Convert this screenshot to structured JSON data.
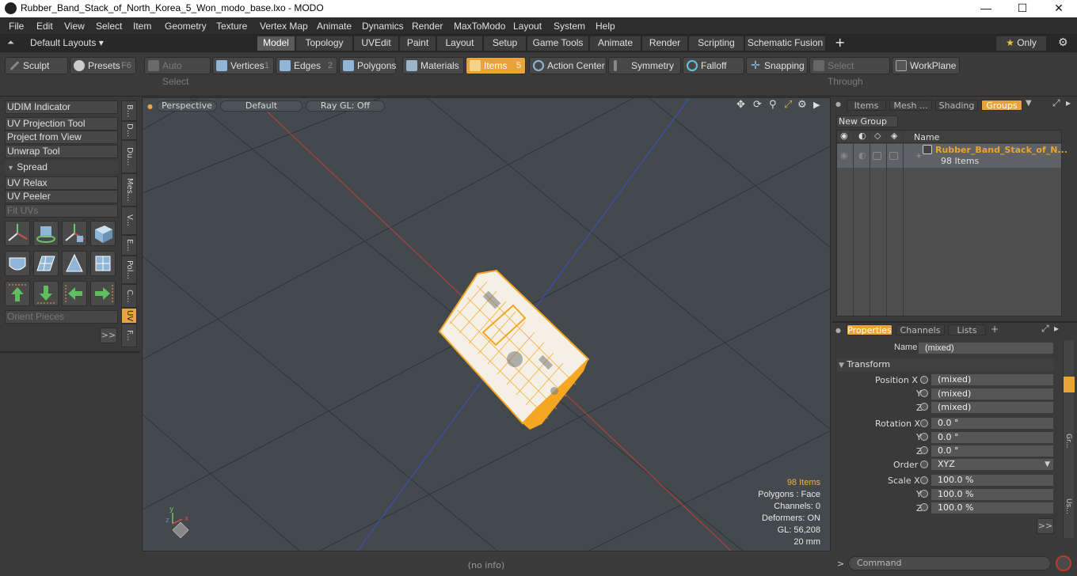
{
  "window": {
    "title": "Rubber_Band_Stack_of_North_Korea_5_Won_modo_base.lxo - MODO",
    "minimize": "—",
    "maximize": "☐",
    "close": "✕"
  },
  "menu": [
    "File",
    "Edit",
    "View",
    "Select",
    "Item",
    "Geometry",
    "Texture",
    "Vertex Map",
    "Animate",
    "Dynamics",
    "Render",
    "MaxToModo",
    "Layout",
    "System",
    "Help"
  ],
  "layout_selector": "Default Layouts",
  "tabs": [
    "Model",
    "Topology",
    "UVEdit",
    "Paint",
    "Layout",
    "Setup",
    "Game Tools",
    "Animate",
    "Render",
    "Scripting",
    "Schematic Fusion"
  ],
  "tab_add": "+",
  "only_button": "Only",
  "toolbar": {
    "sculpt": "Sculpt",
    "presets": "Presets",
    "presets_key": "F6",
    "auto_select": "Auto Select",
    "vertices": "Vertices",
    "vertices_key": "1",
    "edges": "Edges",
    "edges_key": "2",
    "polygons": "Polygons",
    "materials": "Materials",
    "items": "Items",
    "items_key": "5",
    "action_center": "Action Center",
    "symmetry": "Symmetry",
    "falloff": "Falloff",
    "snapping": "Snapping",
    "select_through": "Select Through",
    "workplane": "WorkPlane"
  },
  "left": {
    "udim": "UDIM Indicator",
    "uv_projection": "UV Projection Tool",
    "project_view": "Project from View",
    "unwrap": "Unwrap Tool",
    "spread": "Spread",
    "uv_relax": "UV Relax",
    "uv_peeler": "UV Peeler",
    "fit_uvs": "Fit UVs",
    "orient": "Orient Pieces",
    "more": ">>",
    "vtabs": [
      "B...",
      "D...",
      "Du...",
      "Mes...",
      "V...",
      "E...",
      "Pol...",
      "C...",
      "UV",
      "F..."
    ]
  },
  "viewport": {
    "perspective": "Perspective",
    "default": "Default",
    "raygl": "Ray GL: Off",
    "items_count": "98 Items",
    "polygons": "Polygons : Face",
    "channels": "Channels: 0",
    "deformers": "Deformers: ON",
    "gl": "GL: 56,208",
    "scale": "20 mm"
  },
  "status": "(no info)",
  "right": {
    "tabs": [
      "Items",
      "Mesh ...",
      "Shading",
      "Groups"
    ],
    "new_group": "New Group",
    "col_name": "Name",
    "group_name": "Rubber_Band_Stack_of_N...",
    "group_count": "98 Items",
    "prop_tabs": [
      "Properties",
      "Channels",
      "Lists"
    ],
    "prop_add": "+",
    "name_label": "Name",
    "name_value": "(mixed)",
    "transform": "Transform",
    "position_x_label": "Position X",
    "y_label": "Y",
    "z_label": "Z",
    "pos_x": "(mixed)",
    "pos_y": "(mixed)",
    "pos_z": "(mixed)",
    "rotation_x_label": "Rotation X",
    "rot_x": "0.0 °",
    "rot_y": "0.0 °",
    "rot_z": "0.0 °",
    "order_label": "Order",
    "order": "XYZ",
    "scale_x_label": "Scale X",
    "scl_x": "100.0 %",
    "scl_y": "100.0 %",
    "scl_z": "100.0 %",
    "more": ">>",
    "side_tabs": [
      "Gr...",
      "Us..."
    ],
    "command": "Command"
  },
  "colors": {
    "accent": "#e8a33b",
    "mesh": "#f5a623",
    "x_axis": "#b0413e",
    "z_axis": "#3b4fb8"
  }
}
